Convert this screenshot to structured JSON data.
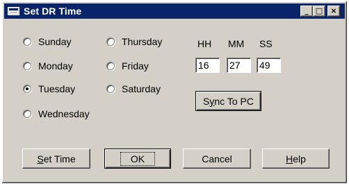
{
  "window": {
    "title": "Set DR Time",
    "icon": "window-app-icon",
    "controls": {
      "minimize": "_",
      "maximize": "□",
      "close": "×"
    }
  },
  "days": [
    {
      "label": "Sunday",
      "checked": false
    },
    {
      "label": "Monday",
      "checked": false
    },
    {
      "label": "Tuesday",
      "checked": true
    },
    {
      "label": "Wednesday",
      "checked": false
    },
    {
      "label": "Thursday",
      "checked": false
    },
    {
      "label": "Friday",
      "checked": false
    },
    {
      "label": "Saturday",
      "checked": false
    }
  ],
  "time": {
    "hh_label": "HH",
    "mm_label": "MM",
    "ss_label": "SS",
    "hh": "16",
    "mm": "27",
    "ss": "49"
  },
  "buttons": {
    "sync": {
      "mnemonic": "y",
      "before": "S",
      "after": "nc To PC"
    },
    "set_time": {
      "mnemonic": "S",
      "before": "",
      "after": "et Time"
    },
    "ok": "OK",
    "cancel": "Cancel",
    "help": {
      "mnemonic": "H",
      "before": "",
      "after": "elp"
    }
  }
}
